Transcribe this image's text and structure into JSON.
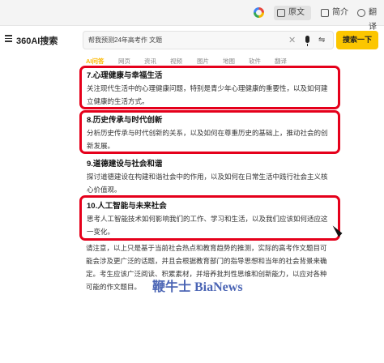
{
  "browser": {
    "original_label": "原文",
    "simple_label": "简介",
    "translate_label": "翻译"
  },
  "search": {
    "brand": "360AI搜索",
    "query": "帮我预测24年高考作 文题",
    "submit_label": "搜索一下"
  },
  "tabs": [
    "AI问答",
    "网页",
    "资讯",
    "视频",
    "图片",
    "地图",
    "软件",
    "翻译"
  ],
  "sections": [
    {
      "title": "7.心理健康与幸福生活",
      "body_lines": [
        "关注现代生活中的心理健康问题，特别是青少年心理健康的重要性，以及如何建",
        "立健康的生活方式。"
      ]
    },
    {
      "title": "8.历史传承与时代创新",
      "body_lines": [
        "分析历史传承与时代创新的关系，以及如何在尊重历史的基础上，推动社会的创",
        "新发展。"
      ]
    },
    {
      "title": "9.道德建设与社会和谐",
      "body_lines": [
        "探讨道德建设在构建和谐社会中的作用，以及如何在日常生活中践行社会主义核",
        "心价值观。"
      ]
    },
    {
      "title": "10.人工智能与未来社会",
      "body_lines": [
        "思考人工智能技术如何影响我们的工作、学习和生活，以及我们应该如何适应这",
        "一变化。"
      ]
    }
  ],
  "note_lines": [
    "请注意，以上只是基于当前社会热点和教育趋势的推测，实际的高考作文题目可",
    "能会涉及更广泛的话题，并且会根据教育部门的指导思想和当年的社会背景来确",
    "定。考生应该广泛阅读、积累素材，并培养批判性思维和创新能力，以应对各种",
    "可能的作文题目。"
  ],
  "watermark": "鞭牛士 BiaNews",
  "colors": {
    "highlight_border": "#e5001b",
    "search_button": "#fcc600",
    "active_tab": "#fcb800",
    "watermark": "#4a64b4"
  },
  "icons": [
    "browser-logo-icon",
    "document-icon",
    "summary-icon",
    "translate-icon",
    "menu-icon",
    "clear-icon",
    "microphone-icon",
    "tune-icon"
  ]
}
